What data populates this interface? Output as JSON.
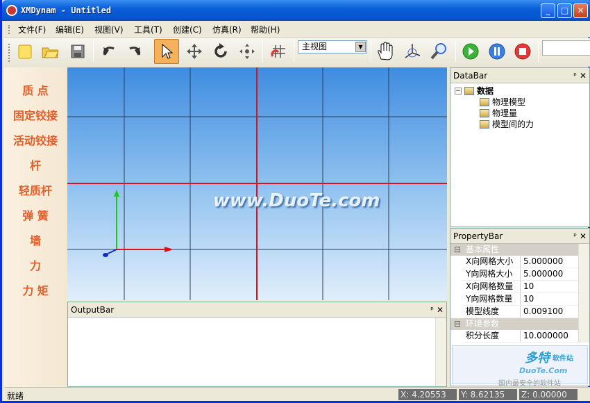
{
  "window": {
    "title": "XMDynam - Untitled",
    "buttons": {
      "minimize": "_",
      "maximize": "□",
      "close": "✕"
    }
  },
  "menu": [
    "文件(F)",
    "编辑(E)",
    "视图(V)",
    "工具(T)",
    "创建(C)",
    "仿真(R)",
    "帮助(H)"
  ],
  "toolbar": {
    "view_select": "主视图"
  },
  "left_panel": [
    "质 点",
    "固定铰接",
    "活动铰接",
    "杆",
    "轻质杆",
    "弹 簧",
    "墙",
    "力",
    "力 矩"
  ],
  "viewport": {
    "watermark": "www.DuoTe.com"
  },
  "output_bar": {
    "title": "OutputBar",
    "pin": "ᵖ",
    "close": "✕"
  },
  "data_bar": {
    "title": "DataBar",
    "pin": "ᵖ",
    "close": "✕",
    "root": "数据",
    "children": [
      "物理模型",
      "物理量",
      "模型间的力"
    ]
  },
  "property_bar": {
    "title": "PropertyBar",
    "pin": "ᵖ",
    "close": "✕",
    "categories": [
      {
        "name": "基本属性",
        "rows": [
          {
            "key": "X向网格大小",
            "value": "5.000000"
          },
          {
            "key": "Y向网格大小",
            "value": "5.000000"
          },
          {
            "key": "X向网格数量",
            "value": "10"
          },
          {
            "key": "Y向网格数量",
            "value": "10"
          },
          {
            "key": "模型线度",
            "value": "0.009100"
          }
        ]
      },
      {
        "name": "环境参数",
        "rows": [
          {
            "key": "积分长度",
            "value": "10.000000"
          }
        ]
      }
    ]
  },
  "status": {
    "text": "就绪",
    "x": "X: 4.20553",
    "y": "Y: 8.62135",
    "z": "Z: 0.00000"
  },
  "logo": {
    "main": "多特",
    "sub": "软件站",
    "site": "DuoTe.Com",
    "tagline": "国内最安全的软件站"
  }
}
